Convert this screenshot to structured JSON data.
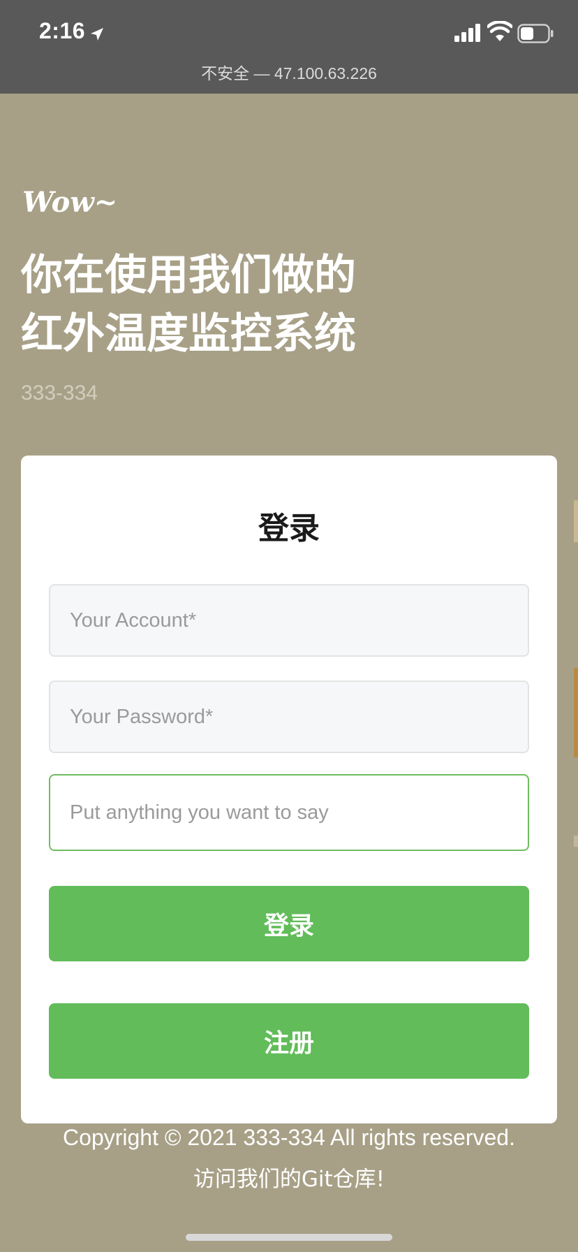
{
  "status_bar": {
    "time": "2:16",
    "icons": [
      "location-arrow-icon",
      "cellular-signal-icon",
      "wifi-icon",
      "battery-icon"
    ]
  },
  "url_bar": {
    "text": "不安全 — 47.100.63.226"
  },
  "hero": {
    "tagline": "Wow~",
    "title_line1": "你在使用我们做的",
    "title_line2": "红外温度监控系统",
    "subtitle": "333-334"
  },
  "login_card": {
    "title": "登录",
    "account_placeholder": "Your Account*",
    "account_value": "",
    "password_placeholder": "Your Password*",
    "password_value": "",
    "message_placeholder": "Put anything you want to say",
    "message_value": "",
    "login_label": "登录",
    "register_label": "注册"
  },
  "footer": {
    "copyright": "Copyright © 2021 333-334 All rights reserved.",
    "repo_link": "访问我们的Git仓库!"
  },
  "colors": {
    "background": "#a7a087",
    "topbar": "#595959",
    "accent_green": "#61bc59",
    "card": "#ffffff"
  }
}
